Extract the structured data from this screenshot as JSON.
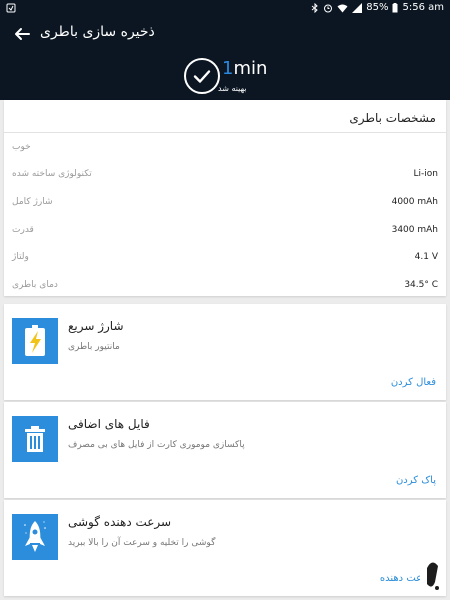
{
  "status_bar": {
    "battery_percent": "85%",
    "time": "5:56 am"
  },
  "header": {
    "title": "ذخیره سازی باطری",
    "time_value": "1",
    "time_unit": "min",
    "optimized_label": "بهینه شد"
  },
  "battery_specs": {
    "title": "مشخصات باطری",
    "rows": [
      {
        "label": "خوب",
        "value": ""
      },
      {
        "label": "تکنولوژی ساخته شده",
        "value": "Li-ion"
      },
      {
        "label": "شارژ کامل",
        "value": "4000 mAh"
      },
      {
        "label": "قدرت",
        "value": "3400 mAh"
      },
      {
        "label": "ولتاژ",
        "value": "4.1 V"
      },
      {
        "label": "دمای باطری",
        "value": "34.5° C"
      }
    ]
  },
  "tools": [
    {
      "title": "شارژ سریع",
      "description": "مانتیور باطری",
      "action": "فعال کردن",
      "icon": "lightning-battery-icon"
    },
    {
      "title": "فایل های اضافی",
      "description": "پاکسازی موموری کارت از فایل های بی مصرف",
      "action": "پاک کردن",
      "icon": "trash-icon"
    },
    {
      "title": "سرعت دهنده گوشی",
      "description": "گوشی را تخلیه و سرعت آن را بالا ببرید",
      "action": "سرعت دهنده",
      "icon": "rocket-icon"
    }
  ],
  "colors": {
    "header_bg": "#0b1622",
    "accent": "#2b8ddb",
    "page_bg": "#ececec"
  }
}
